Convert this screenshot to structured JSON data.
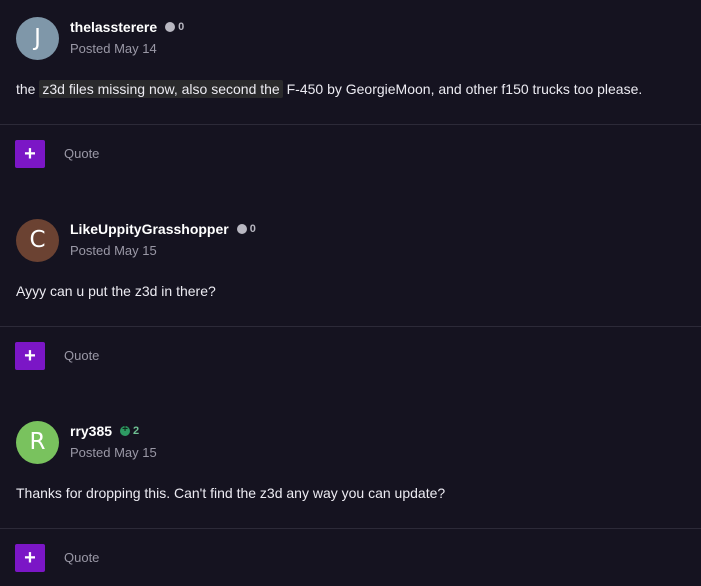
{
  "posts": [
    {
      "avatar_letter": "J",
      "avatar_color": "#7f97a9",
      "author": "thelassterere",
      "reputation": "0",
      "rep_type": "neutral",
      "posted": "Posted May 14",
      "body_before": "the ",
      "body_highlight": "z3d files missing now, also second the",
      "body_after": " F-450 by GeorgieMoon, and other f150 trucks too please.",
      "quote_label": "Quote",
      "plus_label": "+"
    },
    {
      "avatar_letter": "C",
      "avatar_color": "#6b4232",
      "author": "LikeUppityGrasshopper",
      "reputation": "0",
      "rep_type": "neutral",
      "posted": "Posted May 15",
      "body_before": "Ayyy can u put the z3d in there?",
      "body_highlight": "",
      "body_after": "",
      "quote_label": "Quote",
      "plus_label": "+"
    },
    {
      "avatar_letter": "R",
      "avatar_color": "#79c25e",
      "author": "rry385",
      "reputation": "2",
      "rep_type": "positive",
      "posted": "Posted May 15",
      "body_before": "Thanks for dropping this. Can't find the z3d any way you can update?",
      "body_highlight": "",
      "body_after": "",
      "quote_label": "Quote",
      "plus_label": "+"
    }
  ]
}
